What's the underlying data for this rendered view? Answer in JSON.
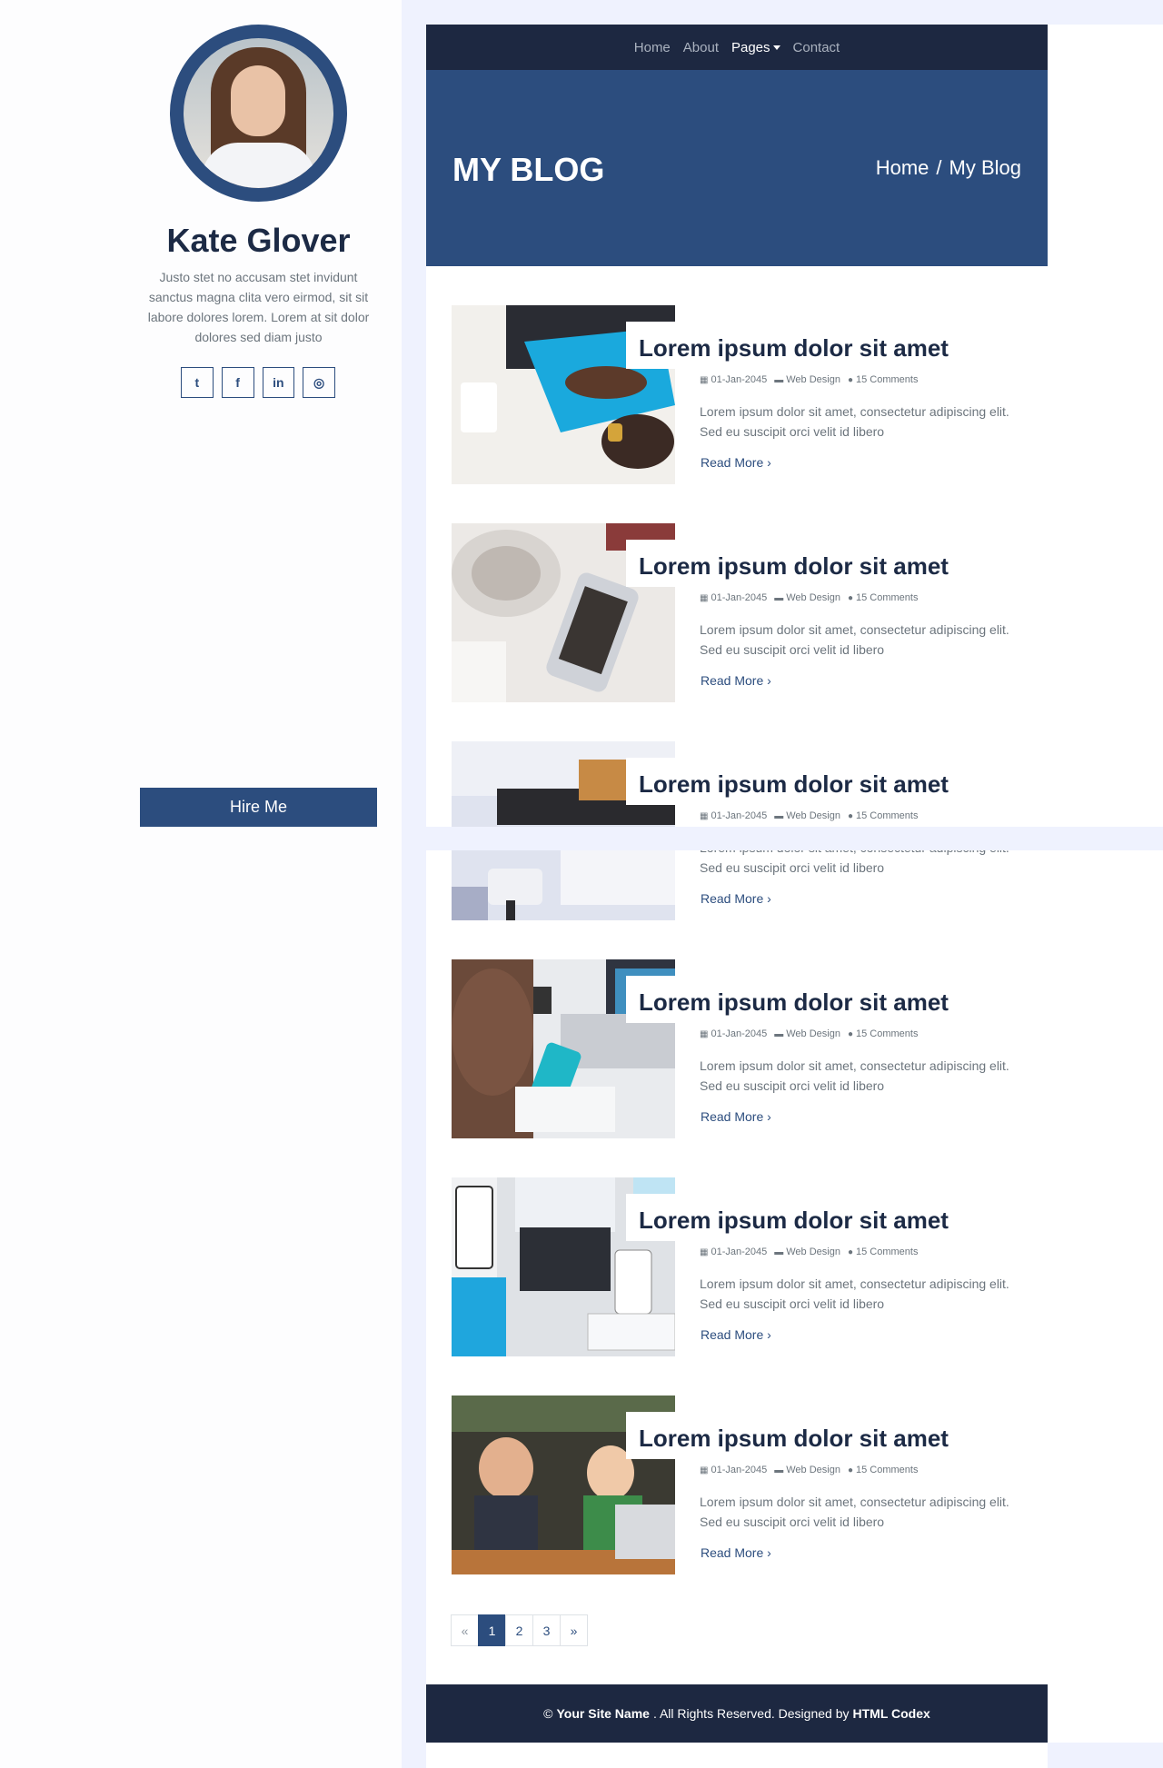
{
  "profile": {
    "name": "Kate Glover",
    "bio": "Justo stet no accusam stet invidunt sanctus magna clita vero eirmod, sit sit labore dolores lorem. Lorem at sit dolor dolores sed diam justo",
    "hire_label": "Hire Me",
    "socials": [
      {
        "icon": "twitter-icon",
        "glyph": "t"
      },
      {
        "icon": "facebook-icon",
        "glyph": "f"
      },
      {
        "icon": "linkedin-icon",
        "glyph": "in"
      },
      {
        "icon": "instagram-icon",
        "glyph": "◎"
      }
    ]
  },
  "nav": {
    "items": [
      "Home",
      "About",
      "Pages",
      "Contact"
    ],
    "active": "Pages"
  },
  "header": {
    "title": "MY BLOG",
    "breadcrumb": [
      "Home",
      "/",
      "My Blog"
    ]
  },
  "posts": [
    {
      "title": "Lorem ipsum dolor sit amet",
      "date": "01-Jan-2045",
      "category": "Web Design",
      "comments": "15 Comments",
      "excerpt": "Lorem ipsum dolor sit amet, consectetur adipiscing elit. Sed eu suscipit orci velit id libero",
      "read_more": "Read More"
    },
    {
      "title": "Lorem ipsum dolor sit amet",
      "date": "01-Jan-2045",
      "category": "Web Design",
      "comments": "15 Comments",
      "excerpt": "Lorem ipsum dolor sit amet, consectetur adipiscing elit. Sed eu suscipit orci velit id libero",
      "read_more": "Read More"
    },
    {
      "title": "Lorem ipsum dolor sit amet",
      "date": "01-Jan-2045",
      "category": "Web Design",
      "comments": "15 Comments",
      "excerpt": "Lorem ipsum dolor sit amet, consectetur adipiscing elit. Sed eu suscipit orci velit id libero",
      "read_more": "Read More"
    },
    {
      "title": "Lorem ipsum dolor sit amet",
      "date": "01-Jan-2045",
      "category": "Web Design",
      "comments": "15 Comments",
      "excerpt": "Lorem ipsum dolor sit amet, consectetur adipiscing elit. Sed eu suscipit orci velit id libero",
      "read_more": "Read More"
    },
    {
      "title": "Lorem ipsum dolor sit amet",
      "date": "01-Jan-2045",
      "category": "Web Design",
      "comments": "15 Comments",
      "excerpt": "Lorem ipsum dolor sit amet, consectetur adipiscing elit. Sed eu suscipit orci velit id libero",
      "read_more": "Read More"
    },
    {
      "title": "Lorem ipsum dolor sit amet",
      "date": "01-Jan-2045",
      "category": "Web Design",
      "comments": "15 Comments",
      "excerpt": "Lorem ipsum dolor sit amet, consectetur adipiscing elit. Sed eu suscipit orci velit id libero",
      "read_more": "Read More"
    }
  ],
  "pagination": {
    "prev": "«",
    "pages": [
      "1",
      "2",
      "3"
    ],
    "next": "»",
    "active": "1"
  },
  "footer": {
    "copyright": "©",
    "site_name": "Your Site Name",
    "rights": ". All Rights Reserved. Designed by",
    "designer": "HTML Codex"
  },
  "colors": {
    "primary": "#2c4d7e",
    "dark": "#1d2841",
    "light_bg": "#eff2fe"
  }
}
